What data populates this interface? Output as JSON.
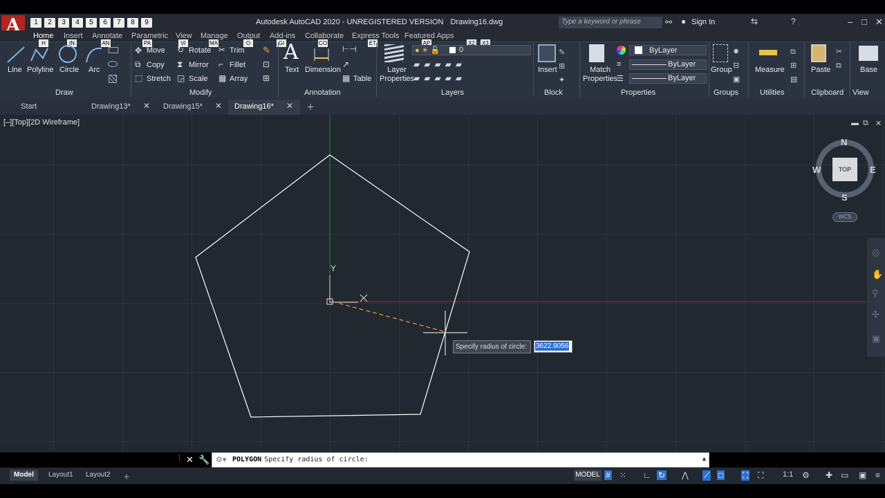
{
  "app": {
    "title": "Autodesk AutoCAD 2020 - UNREGISTERED VERSION",
    "document": "Drawing16.dwg",
    "logo": "A",
    "search_placeholder": "Type a keyword or phrase",
    "sign_in": "Sign In"
  },
  "qat_keys": [
    "1",
    "2",
    "3",
    "4",
    "5",
    "6",
    "7",
    "8",
    "9"
  ],
  "ribbon_tabs": [
    "Home",
    "Insert",
    "Annotate",
    "Parametric",
    "View",
    "Manage",
    "Output",
    "Add-ins",
    "Collaborate",
    "Express Tools",
    "Featured Apps"
  ],
  "keytips": [
    "H",
    "IN",
    "AN",
    "PA",
    "VI",
    "MA",
    "O",
    "GI",
    "CO",
    "ET",
    "AP",
    "X2",
    "X3"
  ],
  "draw": {
    "tools": [
      "Line",
      "Polyline",
      "Circle",
      "Arc"
    ],
    "panel": "Draw"
  },
  "modify": {
    "tools": [
      "Move",
      "Rotate",
      "Trim",
      "Copy",
      "Mirror",
      "Fillet",
      "Stretch",
      "Scale",
      "Array"
    ],
    "panel": "Modify"
  },
  "annotation": {
    "tools": [
      "Text",
      "Dimension",
      "Table"
    ],
    "panel": "Annotation"
  },
  "layers": {
    "tools": [
      "Layer Properties"
    ],
    "current_layer": "0",
    "panel": "Layers"
  },
  "block": {
    "tools": [
      "Insert"
    ],
    "panel": "Block"
  },
  "properties": {
    "match": "Match Properties",
    "color": "ByLayer",
    "linetype": "ByLayer",
    "lineweight": "ByLayer",
    "panel": "Properties"
  },
  "groups": {
    "tools": [
      "Group"
    ],
    "panel": "Groups"
  },
  "utilities": {
    "tools": [
      "Measure"
    ],
    "panel": "Utilities"
  },
  "clipboard": {
    "tools": [
      "Paste"
    ],
    "panel": "Clipboard"
  },
  "view": {
    "tools": [
      "Base"
    ],
    "panel": "View"
  },
  "doc_tabs": [
    "Start",
    "Drawing13*",
    "Drawing15*",
    "Drawing16*"
  ],
  "viewport": {
    "label": "[–][Top][2D Wireframe]",
    "compass": {
      "n": "N",
      "s": "S",
      "e": "E",
      "w": "W",
      "cube": "TOP"
    },
    "wcs": "WCS",
    "y_axis": "Y"
  },
  "prompt": {
    "tooltip": "Specify radius of circle:",
    "value": "3622.9056"
  },
  "command": {
    "name": "POLYGON",
    "text": "Specify radius of circle:"
  },
  "layout_tabs": [
    "Model",
    "Layout1",
    "Layout2"
  ],
  "status": {
    "model": "MODEL",
    "scale": "1:1"
  },
  "colors": {
    "background": "#212830",
    "ribbon": "#2c3340",
    "polygon": "#ffffff",
    "rubber_band": "#e3a33a",
    "accent": "#2f6fd0",
    "logo": "#b3241e"
  }
}
